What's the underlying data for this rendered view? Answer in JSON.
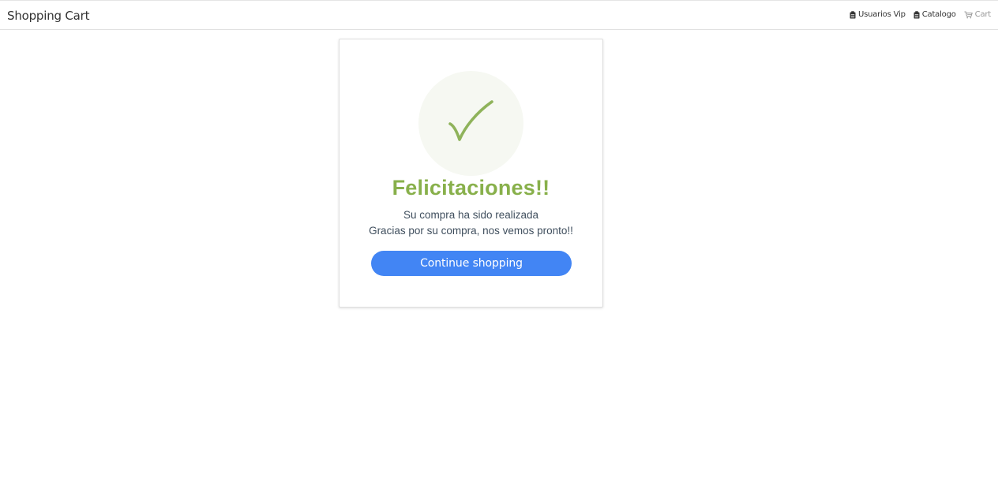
{
  "navbar": {
    "brand": "Shopping Cart",
    "links": [
      {
        "label": "Usuarios Vip",
        "icon": "clipboard-icon"
      },
      {
        "label": "Catalogo",
        "icon": "clipboard-icon"
      },
      {
        "label": "Cart",
        "icon": "cart-icon"
      }
    ]
  },
  "card": {
    "icon": "checkmark-icon",
    "title": "Felicitaciones!!",
    "message_line1": "Su compra ha sido realizada",
    "message_line2": "Gracias por su compra, nos vemos pronto!!",
    "button_label": "Continue shopping"
  },
  "colors": {
    "accent_green": "#88b04b",
    "button_blue": "#4285f4",
    "circle_bg": "#f6f8f2",
    "text": "#404f5e"
  }
}
